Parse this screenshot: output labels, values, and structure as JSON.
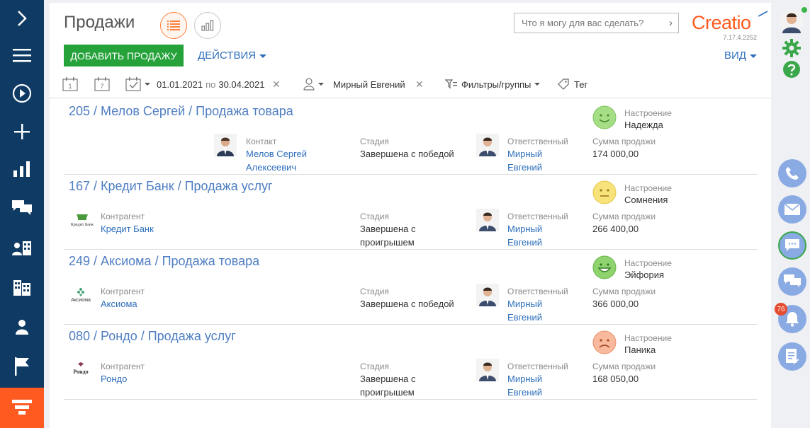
{
  "page": {
    "title": "Продажи",
    "add_button": "ДОБАВИТЬ ПРОДАЖУ",
    "actions_button": "ДЕЙСТВИЯ",
    "view_button": "ВИД",
    "search_placeholder": "Что я могу для вас сделать?",
    "logo_text": "Creatio",
    "version": "7.17.4.2252"
  },
  "filters": {
    "day_icon_label": "1",
    "week_icon_label": "7",
    "date_from": "01.01.2021",
    "date_sep": "по",
    "date_to": "30.04.2021",
    "owner": "Мирный Евгений",
    "filters_groups": "Фильтры/группы",
    "tag": "Тег"
  },
  "colors": {
    "nav_bg": "#0e3a64",
    "accent": "#ff5a1f",
    "link": "#2e6fbb",
    "add_button": "#25a23a",
    "right_button": "#8aaae3"
  },
  "labels": {
    "contact": "Контакт",
    "account": "Контрагент",
    "stage": "Стадия",
    "owner": "Ответственный",
    "mood": "Настроение",
    "amount": "Сумма продажи"
  },
  "records": [
    {
      "title": "205 / Мелов Сергей / Продажа товара",
      "party_label": "Контакт",
      "party_line1": "Мелов Сергей",
      "party_line2": "Алексеевич",
      "stage_line1": "Завершена с победой",
      "stage_line2": "",
      "owner_line1": "Мирный",
      "owner_line2": "Евгений",
      "mood": "Надежда",
      "mood_color": "#8fd16a",
      "amount": "174 000,00"
    },
    {
      "title": "167 / Кредит Банк / Продажа услуг",
      "party_label": "Контрагент",
      "party_line1": "Кредит Банк",
      "party_line2": "",
      "logo_text": "Кредит Банк",
      "stage_line1": "Завершена с",
      "stage_line2": "проигрышем",
      "owner_line1": "Мирный",
      "owner_line2": "Евгений",
      "mood": "Сомнения",
      "mood_color": "#f7dd5a",
      "amount": "266 400,00"
    },
    {
      "title": "249 / Аксиома / Продажа товара",
      "party_label": "Контрагент",
      "party_line1": "Аксиома",
      "party_line2": "",
      "logo_text": "Аксиома",
      "stage_line1": "Завершена с победой",
      "stage_line2": "",
      "owner_line1": "Мирный",
      "owner_line2": "Евгений",
      "mood": "Эйфория",
      "mood_color": "#6fcf5a",
      "amount": "366 000,00"
    },
    {
      "title": "080 / Рондо / Продажа услуг",
      "party_label": "Контрагент",
      "party_line1": "Рондо",
      "party_line2": "",
      "logo_text": "Рондо",
      "stage_line1": "Завершена с",
      "stage_line2": "проигрышем",
      "owner_line1": "Мирный",
      "owner_line2": "Евгений",
      "mood": "Паника",
      "mood_color": "#f7a98a",
      "amount": "168 050,00"
    }
  ],
  "right_panel": {
    "notifications_count": "76"
  }
}
